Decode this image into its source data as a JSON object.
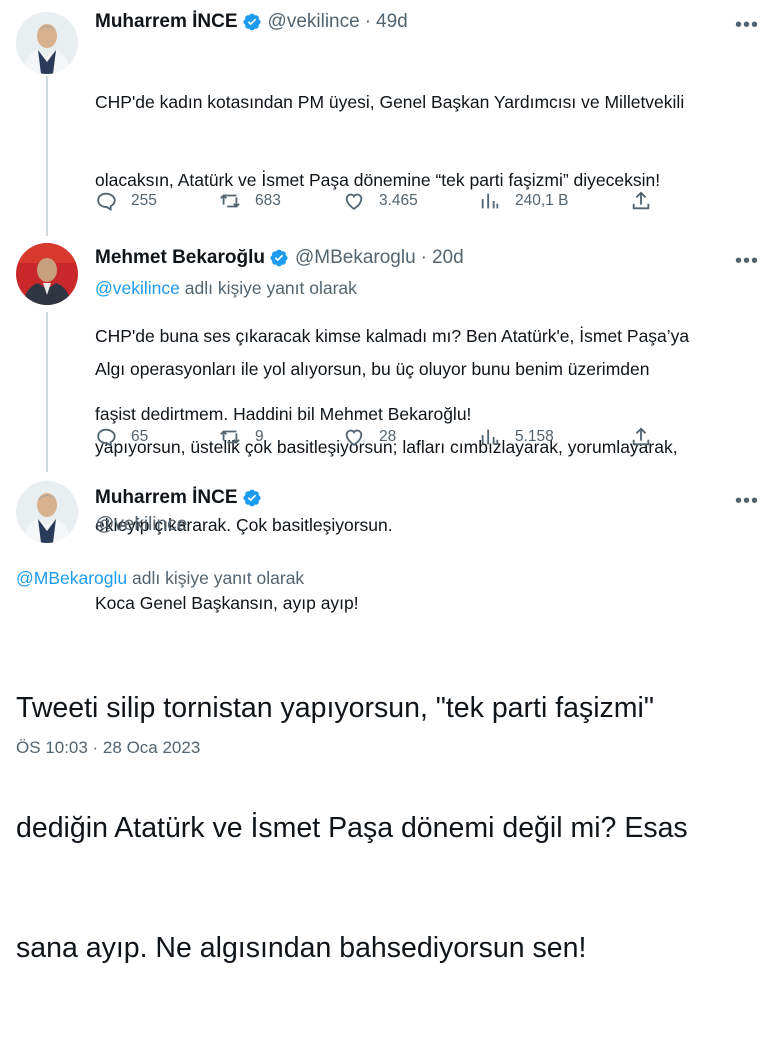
{
  "tweets": [
    {
      "name": "Muharrem İNCE",
      "handle": "@vekilince",
      "sep": "·",
      "time": "49d",
      "more": "•••",
      "lines": [
        "CHP'de kadın kotasından PM üyesi, Genel Başkan Yardımcısı ve Milletvekili",
        "olacaksın, Atatürk ve İsmet Paşa dönemine “tek parti faşizmi” diyeceksin!",
        "",
        "CHP'de buna ses çıkaracak kimse kalmadı mı? Ben Atatürk'e, İsmet Paşa’ya",
        "faşist dedirtmem. Haddini bil Mehmet Bekaroğlu!"
      ],
      "stats": {
        "replies": "255",
        "retweets": "683",
        "likes": "3.465",
        "views": "240,1 B"
      }
    },
    {
      "name": "Mehmet Bekaroğlu",
      "handle": "@MBekaroglu",
      "sep": "·",
      "time": "20d",
      "more": "•••",
      "reply_mention": "@vekilince",
      "reply_suffix": " adlı kişiye yanıt olarak",
      "lines": [
        "Algı operasyonları ile yol alıyorsun, bu üç oluyor bunu benim üzerimden",
        "yapıyorsun, üstelik çok basitleşiyorsun; lafları cımbızlayarak, yorumlayarak,",
        "ekleyip çıkararak. Çok basitleşiyorsun.",
        "Koca Genel Başkansın, ayıp ayıp!"
      ],
      "stats": {
        "replies": "65",
        "retweets": "9",
        "likes": "28",
        "views": "5.158"
      }
    },
    {
      "name": "Muharrem İNCE",
      "handle": "@vekilince",
      "more": "•••",
      "reply_mention": "@MBekaroglu",
      "reply_suffix": " adlı kişiye yanıt olarak",
      "big_lines": [
        "Tweeti silip tornistan yapıyorsun, \"tek parti faşizmi\"",
        "dediğin Atatürk ve İsmet Paşa dönemi değil mi? Esas",
        "sana ayıp. Ne algısından bahsediyorsun sen!"
      ],
      "timestamp": "ÖS 10:03 · 28 Oca 2023"
    }
  ],
  "icons": {
    "reply": "reply-icon",
    "retweet": "retweet-icon",
    "like": "like-icon",
    "views": "views-icon",
    "share": "share-icon",
    "verified": "verified-badge-icon"
  },
  "colors": {
    "accent": "#1d9bf0",
    "secondary": "#536471",
    "text": "#0f1419",
    "line": "#cfd9de"
  }
}
